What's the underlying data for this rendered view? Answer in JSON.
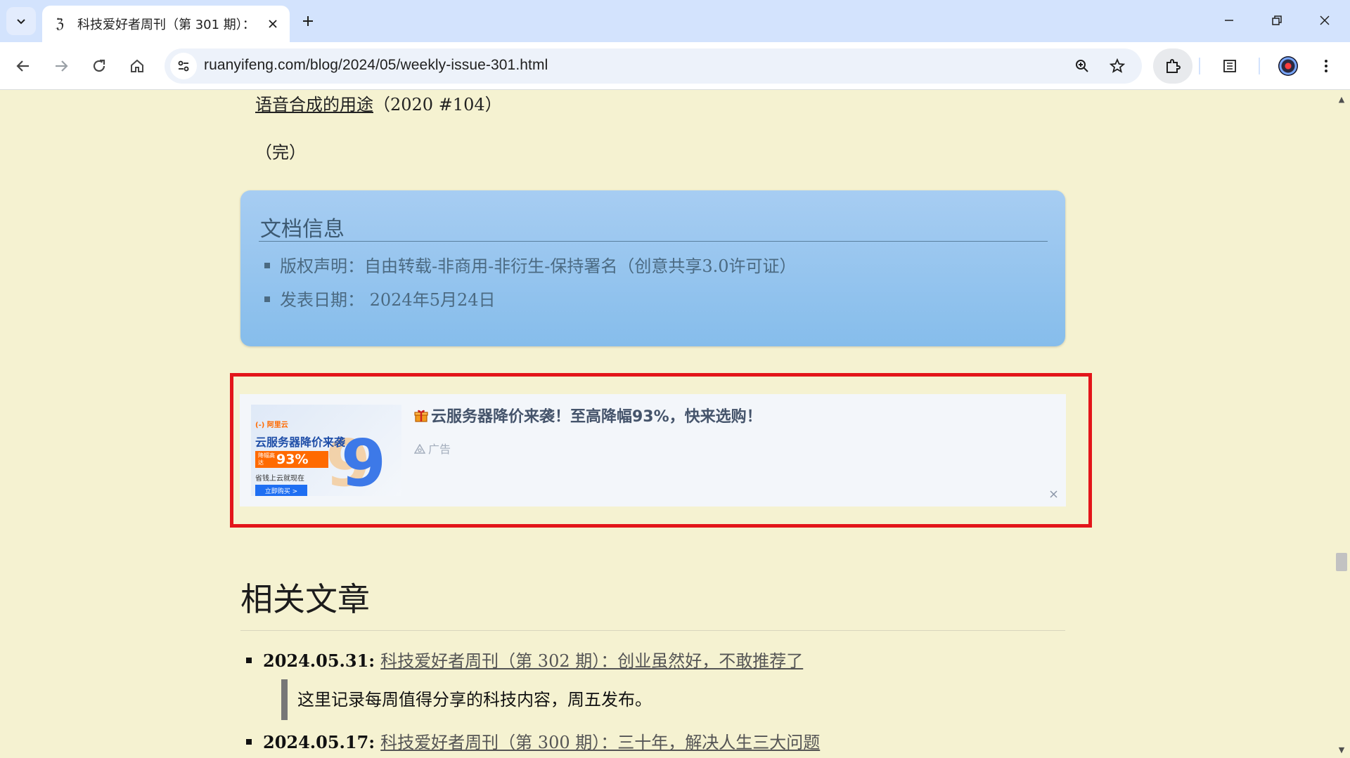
{
  "browser": {
    "tab_title": "科技爱好者周刊（第 301 期）：",
    "url": "ruanyifeng.com/blog/2024/05/weekly-issue-301.html",
    "favicon_glyph": "ℨ"
  },
  "article": {
    "prev_link_text": "语音合成的用途",
    "prev_link_suffix": "（2020 #104）",
    "end_mark": "（完）"
  },
  "doc_info": {
    "title": "文档信息",
    "items": [
      "版权声明：自由转载-非商用-非衍生-保持署名（创意共享3.0许可证）",
      "发表日期： 2024年5月24日"
    ]
  },
  "ad": {
    "title": "云服务器降价来袭！至高降幅93%，快来选购！",
    "label": "广告",
    "image": {
      "logo": "(-) 阿里云",
      "headline": "云服务器降价来袭",
      "badge_small": "降幅高达",
      "badge_big": "93%",
      "subline": "省钱上云就现在",
      "cta": "立即购买 >",
      "big_number": "9"
    },
    "highlight_color": "#e3151a"
  },
  "related": {
    "title": "相关文章",
    "items": [
      {
        "date": "2024.05.31:",
        "link": "科技爱好者周刊（第 302 期）：创业虽然好，不敢推荐了"
      },
      {
        "date": "2024.05.17:",
        "link": "科技爱好者周刊（第 300 期）：三十年，解决人生三大问题"
      }
    ],
    "quote": "这里记录每周值得分享的科技内容，周五发布。"
  },
  "colors": {
    "page_bg": "#f5f2d1",
    "docinfo_bg": "#93c4ee",
    "tabbar_bg": "#d3e3fd"
  }
}
